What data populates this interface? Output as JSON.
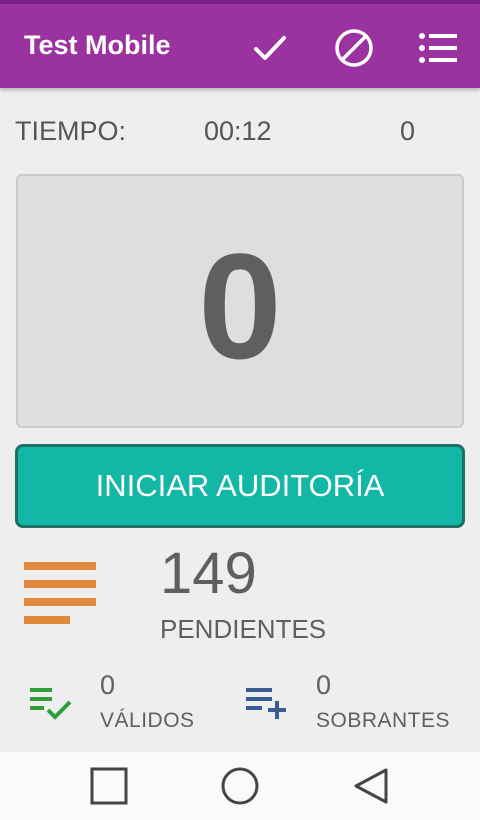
{
  "appbar": {
    "title": "Test Mobile",
    "icons": [
      "check-icon",
      "block-icon",
      "list-icon"
    ]
  },
  "timer": {
    "label": "TIEMPO:",
    "value": "00:12",
    "count": "0"
  },
  "counter": {
    "value": "0"
  },
  "actions": {
    "start_label": "INICIAR AUDITORÍA"
  },
  "pending": {
    "count": "149",
    "label": "PENDIENTES",
    "icon": "sort-lines-icon"
  },
  "valid": {
    "count": "0",
    "label": "VÁLIDOS",
    "icon": "playlist-check-icon"
  },
  "extra": {
    "count": "0",
    "label": "SOBRANTES",
    "icon": "playlist-add-icon"
  },
  "navigation": {
    "icons": [
      "recent-apps-icon",
      "home-icon",
      "back-icon"
    ]
  },
  "colors": {
    "appbar": "#9a32a0",
    "button": "#13b7a6",
    "pending_icon": "#e0893a",
    "valid_icon": "#2e9e3a",
    "extra_icon": "#3b5b95"
  }
}
